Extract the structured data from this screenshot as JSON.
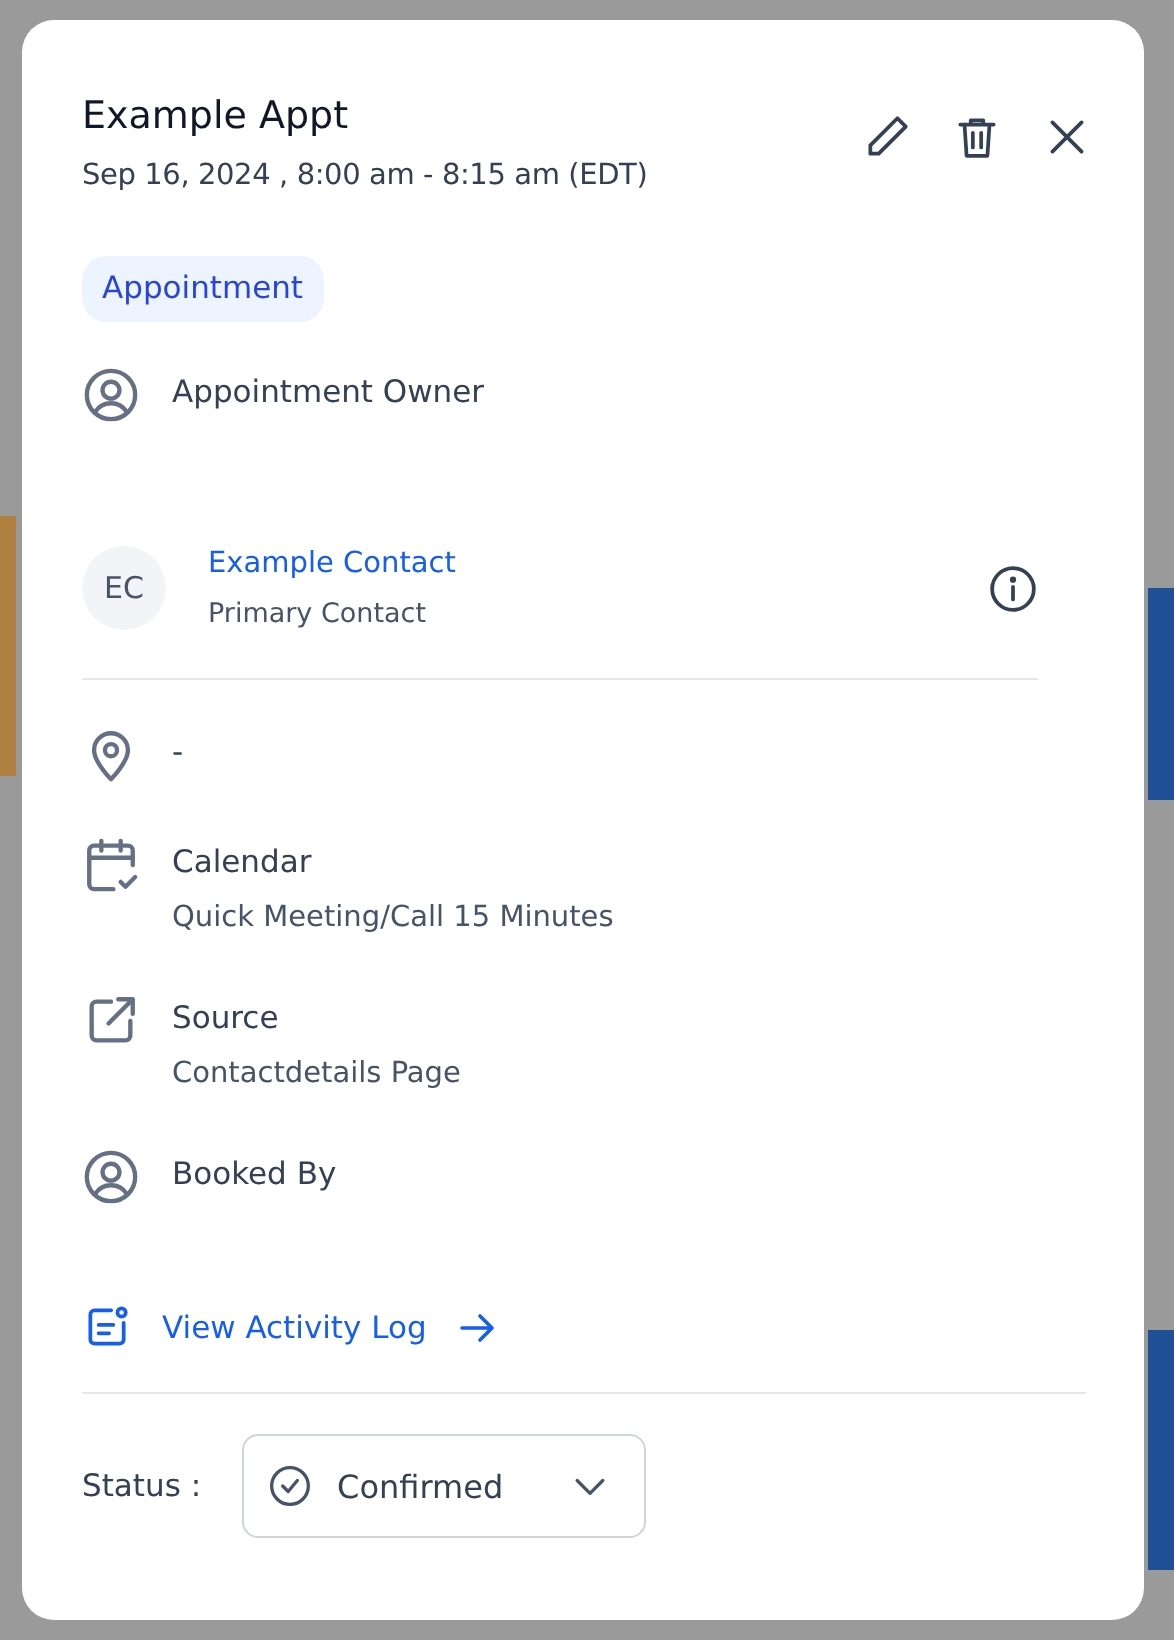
{
  "dialog": {
    "title": "Example Appt",
    "datetime": "Sep 16, 2024 , 8:00 am - 8:15 am (EDT)",
    "tag": "Appointment",
    "owner": {
      "kind": "person",
      "label": "Appointment Owner"
    },
    "contact": {
      "initials": "EC",
      "name": "Example Contact",
      "role": "Primary Contact"
    },
    "details": [
      {
        "kind": "location",
        "label": "-"
      },
      {
        "kind": "calendar",
        "label": "Calendar",
        "value": "Quick Meeting/Call 15 Minutes"
      },
      {
        "kind": "source",
        "label": "Source",
        "value": "Contactdetails Page"
      },
      {
        "kind": "person",
        "label": "Booked By"
      }
    ],
    "activity_link": "View Activity Log",
    "status": {
      "label": "Status :",
      "value": "Confirmed"
    }
  }
}
